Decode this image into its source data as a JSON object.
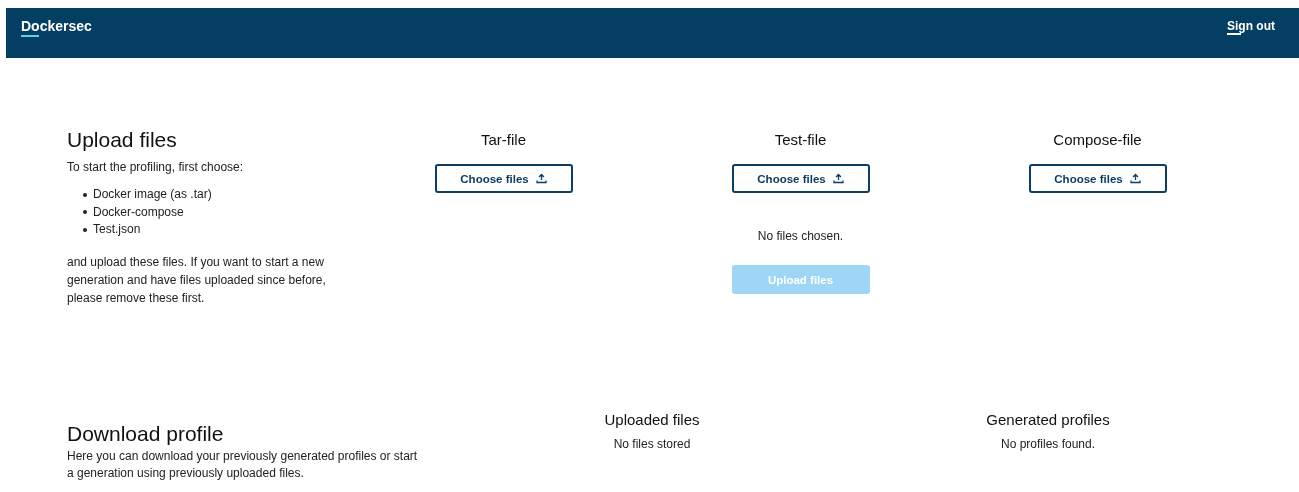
{
  "header": {
    "brand": "Dockersec",
    "sign_out": "Sign out"
  },
  "upload": {
    "title": "Upload files",
    "intro": "To start the profiling, first choose:",
    "items": [
      "Docker image (as .tar)",
      "Docker-compose",
      "Test.json"
    ],
    "outro": "and upload these files. If you want to start a new generation and have files uploaded since before, please remove these first.",
    "columns": [
      {
        "title": "Tar-file",
        "button": "Choose files"
      },
      {
        "title": "Test-file",
        "button": "Choose files",
        "status": "No files chosen.",
        "upload_button": {
          "label": "Upload files",
          "disabled": true
        }
      },
      {
        "title": "Compose-file",
        "button": "Choose files"
      }
    ]
  },
  "download": {
    "title": "Download profile",
    "text": "Here you can download your previously generated profiles or start a generation using previously uploaded files.",
    "columns": [
      {
        "title": "Uploaded files",
        "status": "No files stored"
      },
      {
        "title": "Generated profiles",
        "status": "No profiles found."
      }
    ]
  }
}
